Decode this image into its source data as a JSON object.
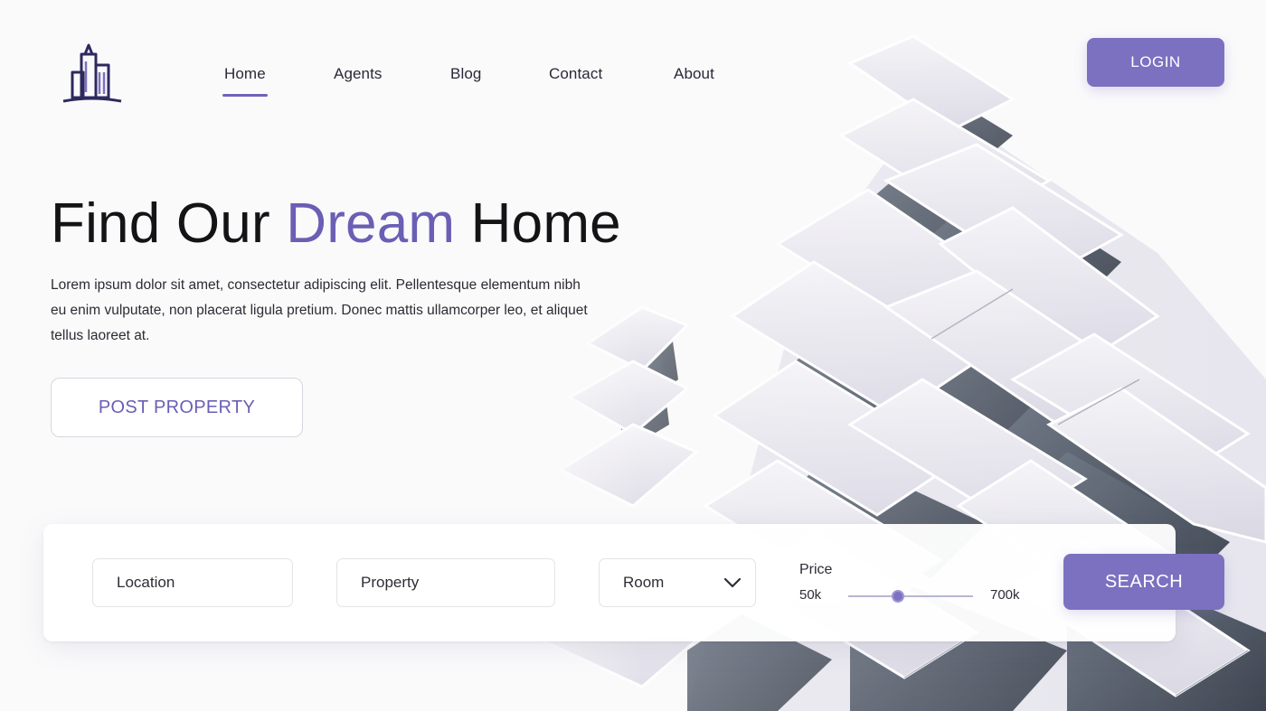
{
  "nav": {
    "items": [
      {
        "label": "Home",
        "active": true
      },
      {
        "label": "Agents",
        "active": false
      },
      {
        "label": "Blog",
        "active": false
      },
      {
        "label": "Contact",
        "active": false
      },
      {
        "label": "About",
        "active": false
      }
    ],
    "login_label": "LOGIN"
  },
  "logo": {
    "icon": "buildings-logo-icon"
  },
  "hero": {
    "title_part1": "Find Our ",
    "title_accent": "Dream",
    "title_part2": " Home",
    "description": "Lorem ipsum dolor sit amet, consectetur adipiscing elit. Pellentesque elementum nibh eu enim vulputate, non placerat ligula pretium. Donec mattis ullamcorper leo, et aliquet tellus laoreet at.",
    "post_button": "POST PROPERTY"
  },
  "search": {
    "location_placeholder": "Location",
    "property_placeholder": "Property",
    "room_value": "Room",
    "room_icon": "chevron-down-icon",
    "price_label": "Price",
    "price_min": "50k",
    "price_max": "700k",
    "price_slider_level": 0,
    "search_button": "SEARCH"
  },
  "colors": {
    "accent": "#7b71c0",
    "accent_text": "#6a5fb4",
    "background": "#fbfafb",
    "heading": "#141316"
  }
}
